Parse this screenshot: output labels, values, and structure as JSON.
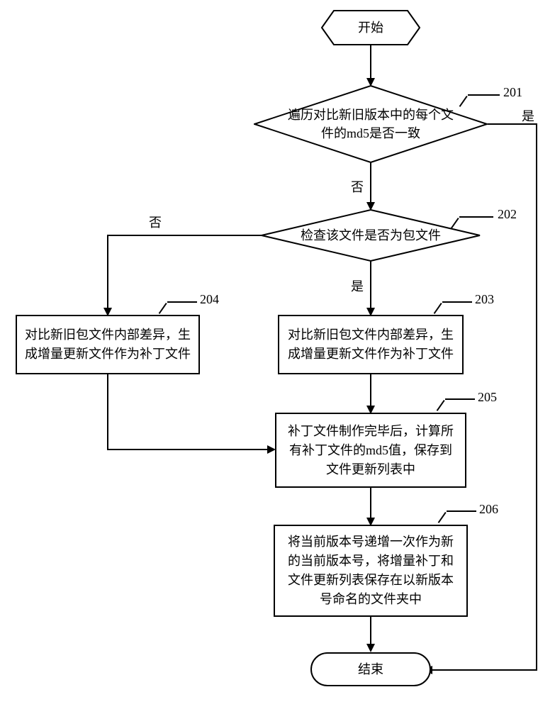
{
  "flow": {
    "start": "开始",
    "end": "结束",
    "d201": "遍历对比新旧版本中的每个文件的md5是否一致",
    "d202": "检查该文件是否为包文件",
    "p203": "对比新旧包文件内部差异，生成增量更新文件作为补丁文件",
    "p204": "对比新旧包文件内部差异，生成增量更新文件作为补丁文件",
    "p205": "补丁文件制作完毕后，计算所有补丁文件的md5值，保存到文件更新列表中",
    "p206": "将当前版本号递增一次作为新的当前版本号，将增量补丁和文件更新列表保存在以新版本号命名的文件夹中",
    "yes": "是",
    "no": "否",
    "n201": "201",
    "n202": "202",
    "n203": "203",
    "n204": "204",
    "n205": "205",
    "n206": "206"
  }
}
